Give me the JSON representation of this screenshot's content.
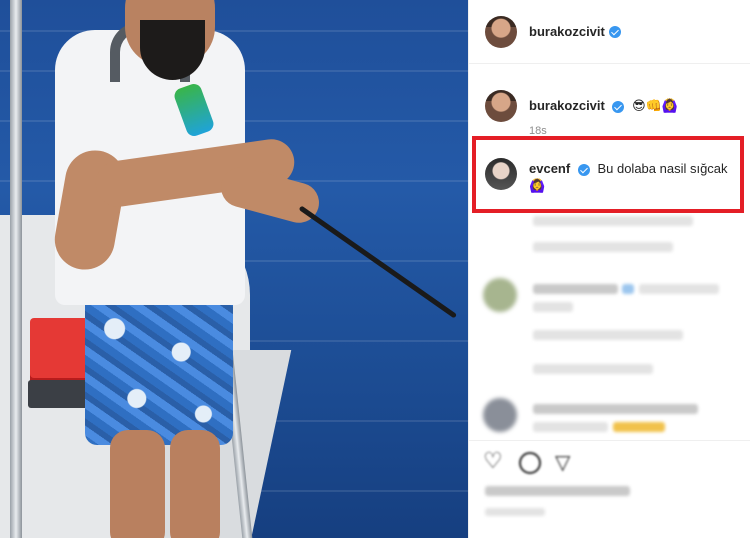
{
  "header": {
    "username": "burakozcivit"
  },
  "caption": {
    "username": "burakozcivit",
    "emojis": "😎👊🙆‍♀️",
    "time": "18s"
  },
  "highlighted_comment": {
    "username": "evcenf",
    "text": "Bu dolaba nasil sığcak",
    "emoji": "🙆‍♀️"
  },
  "actions": {
    "icons": [
      "heart-icon",
      "comment-icon",
      "share-icon"
    ]
  },
  "colors": {
    "highlight_border": "#e41e26",
    "verified_badge": "#3897f0"
  }
}
